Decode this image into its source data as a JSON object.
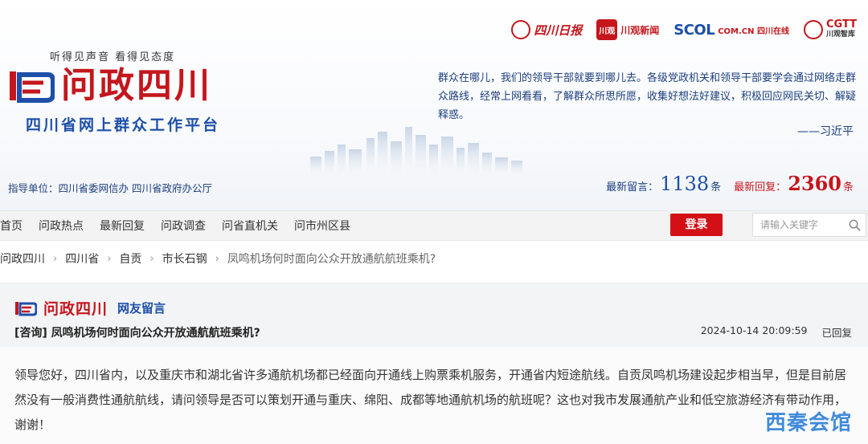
{
  "header": {
    "partners": [
      {
        "name": "四川日报",
        "icon": "sichuan-daily-logo"
      },
      {
        "name": "川观新闻",
        "badge": "川观",
        "icon": "chuanguan-logo"
      },
      {
        "name": "SCOL",
        "sub": "COM.CN 四川在线",
        "icon": "scol-logo"
      },
      {
        "name": "CGTT",
        "sub": "川观智库",
        "icon": "cgtt-logo"
      }
    ],
    "slogan": "听得见声音  看得见态度",
    "logo_title": "问政四川",
    "platform": "四川省网上群众工作平台",
    "quote": "群众在哪儿，我们的领导干部就要到哪儿去。各级党政机关和领导干部要学会通过网络走群众路线，经常上网看看，了解群众所思所愿，收集好想法好建议，积极回应网民关切、解疑释惑。",
    "quote_author": "——习近平",
    "guidance": "指导单位：四川省委网信办  四川省政府办公厅",
    "stats": {
      "latest_msg_label": "最新留言：",
      "latest_msg_count": "1138",
      "latest_msg_unit": "条",
      "latest_reply_label": "最新回复：",
      "latest_reply_count": "2360",
      "latest_reply_unit": "条"
    },
    "colors": {
      "brand_red": "#c4161c",
      "brand_blue": "#1d4fa8"
    }
  },
  "nav": {
    "items": [
      "首页",
      "问政热点",
      "最新回复",
      "问政调查",
      "问省直机关",
      "问市州区县"
    ],
    "login_label": "登录",
    "search_placeholder": "请输入关键字"
  },
  "breadcrumb": [
    "问政四川",
    "四川省",
    "自贡",
    "市长石钢",
    "凤鸣机场何时面向公众开放通航航班乘机?"
  ],
  "post": {
    "brand_title": "问政四川",
    "brand_sub": "网友留言",
    "title": "[咨询] 凤鸣机场何时面向公众开放通航航班乘机?",
    "datetime": "2024-10-14 20:09:59",
    "status": "已回复",
    "body": "领导您好，四川省内，以及重庆市和湖北省许多通航机场都已经面向开通线上购票乘机服务，开通省内短途航线。自贡凤鸣机场建设起步相当早，但是目前居然没有一般消费性通航航线，请问领导是否可以策划开通与重庆、绵阳、成都等地通航机场的航班呢？这也对我市发展通航产业和低空旅游经济有带动作用，谢谢！"
  },
  "watermark": "西秦会馆"
}
